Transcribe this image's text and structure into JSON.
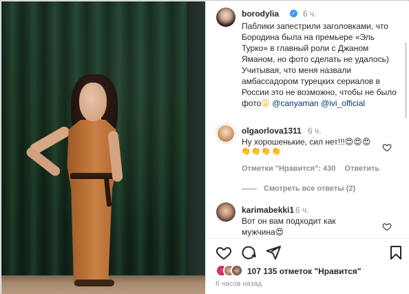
{
  "post": {
    "author": "borodylia",
    "time": "6 ч.",
    "caption_text": "Паблики запестрили заголовками, что Бородина была на премьере «Эль Турко» в главный роли с Джаном Яманом, но фото сделать не удалось) Учитывая, что меня назвали амбассадором турецких сериалов в России это не возможно, чтобы не было фото",
    "caption_emoji": "😜",
    "mention_1": "@canyaman",
    "mention_2": "@ivi_official"
  },
  "comments": [
    {
      "author": "olgaorlova1311",
      "time": "6 ч.",
      "text": "Ну хорошенькие, сил нет!!!😍😍😍",
      "emojis": "👏👏👏👏",
      "likes_label": "Отметки \"Нравится\": 430",
      "reply_label": "Ответить",
      "see_replies": "Смотреть все ответы (2)"
    },
    {
      "author": "karimabekki1",
      "time": "6 ч.",
      "text": "Вот он вам подходит как мужчина😍"
    }
  ],
  "footer": {
    "likes": "107 135 отметок \"Нравится\"",
    "ago": "6 часов назад"
  },
  "icons": {
    "verified": "verified-badge-icon",
    "heart": "heart-icon",
    "comment": "comment-icon",
    "share": "share-icon",
    "save": "bookmark-icon"
  }
}
